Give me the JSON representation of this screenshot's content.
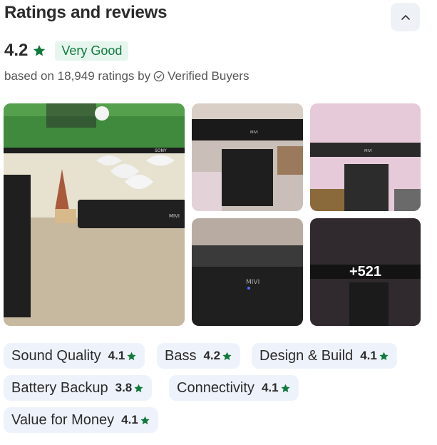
{
  "header": {
    "title": "Ratings and reviews"
  },
  "summary": {
    "rating": "4.2",
    "badge": "Very Good",
    "based_on": "based on 18,949 ratings by",
    "verified": "Verified Buyers"
  },
  "gallery": {
    "more_count": "+521",
    "photo_brand_text": "MIVI",
    "tv_brand_text": "SONY"
  },
  "aspects": [
    {
      "label": "Sound Quality",
      "score": "4.1"
    },
    {
      "label": "Bass",
      "score": "4.2"
    },
    {
      "label": "Design & Build",
      "score": "4.1"
    },
    {
      "label": "Battery Backup",
      "score": "3.8"
    },
    {
      "label": "Connectivity",
      "score": "4.1"
    },
    {
      "label": "Value for Money",
      "score": "4.1"
    }
  ],
  "colors": {
    "star_green": "#0f7a3b",
    "badge_bg": "#e6f6ee",
    "chip_bg": "#eef3fb"
  },
  "icons": [
    "chevron-up-icon",
    "star-icon",
    "verified-check-icon"
  ]
}
